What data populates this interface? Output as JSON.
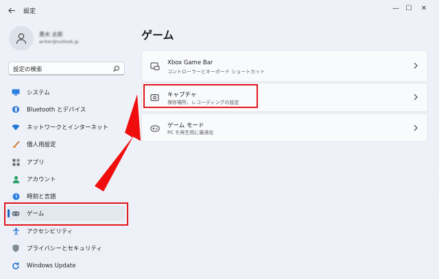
{
  "app": {
    "title": "設定"
  },
  "window_controls": {
    "min": "—",
    "max": "☐",
    "close": "✕"
  },
  "profile": {
    "name": "黒木 太郎",
    "email": "writer@outlook.jp"
  },
  "search": {
    "placeholder": "設定の検索"
  },
  "sidebar": {
    "items": [
      {
        "label": "システム",
        "icon": "monitor-icon"
      },
      {
        "label": "Bluetooth とデバイス",
        "icon": "bluetooth-icon"
      },
      {
        "label": "ネットワークとインターネット",
        "icon": "wifi-icon"
      },
      {
        "label": "個人用設定",
        "icon": "brush-icon"
      },
      {
        "label": "アプリ",
        "icon": "apps-icon"
      },
      {
        "label": "アカウント",
        "icon": "person-icon"
      },
      {
        "label": "時刻と言語",
        "icon": "globe-clock-icon"
      },
      {
        "label": "ゲーム",
        "icon": "gamepad-icon",
        "selected": true
      },
      {
        "label": "アクセシビリティ",
        "icon": "accessibility-icon"
      },
      {
        "label": "プライバシーとセキュリティ",
        "icon": "shield-icon"
      },
      {
        "label": "Windows Update",
        "icon": "update-icon"
      }
    ]
  },
  "main": {
    "title": "ゲーム",
    "cards": [
      {
        "title": "Xbox Game Bar",
        "subtitle": "コントローラーとキーボード ショートカット",
        "icon": "game-bar-icon"
      },
      {
        "title": "キャプチャ",
        "subtitle": "保存場所、レコーディングの設定",
        "icon": "capture-icon"
      },
      {
        "title": "ゲーム モード",
        "subtitle": "PC を再生用に最適化",
        "icon": "game-mode-icon"
      }
    ]
  },
  "colors": {
    "highlight": "#e3141b",
    "accent": "#1a64c6"
  }
}
